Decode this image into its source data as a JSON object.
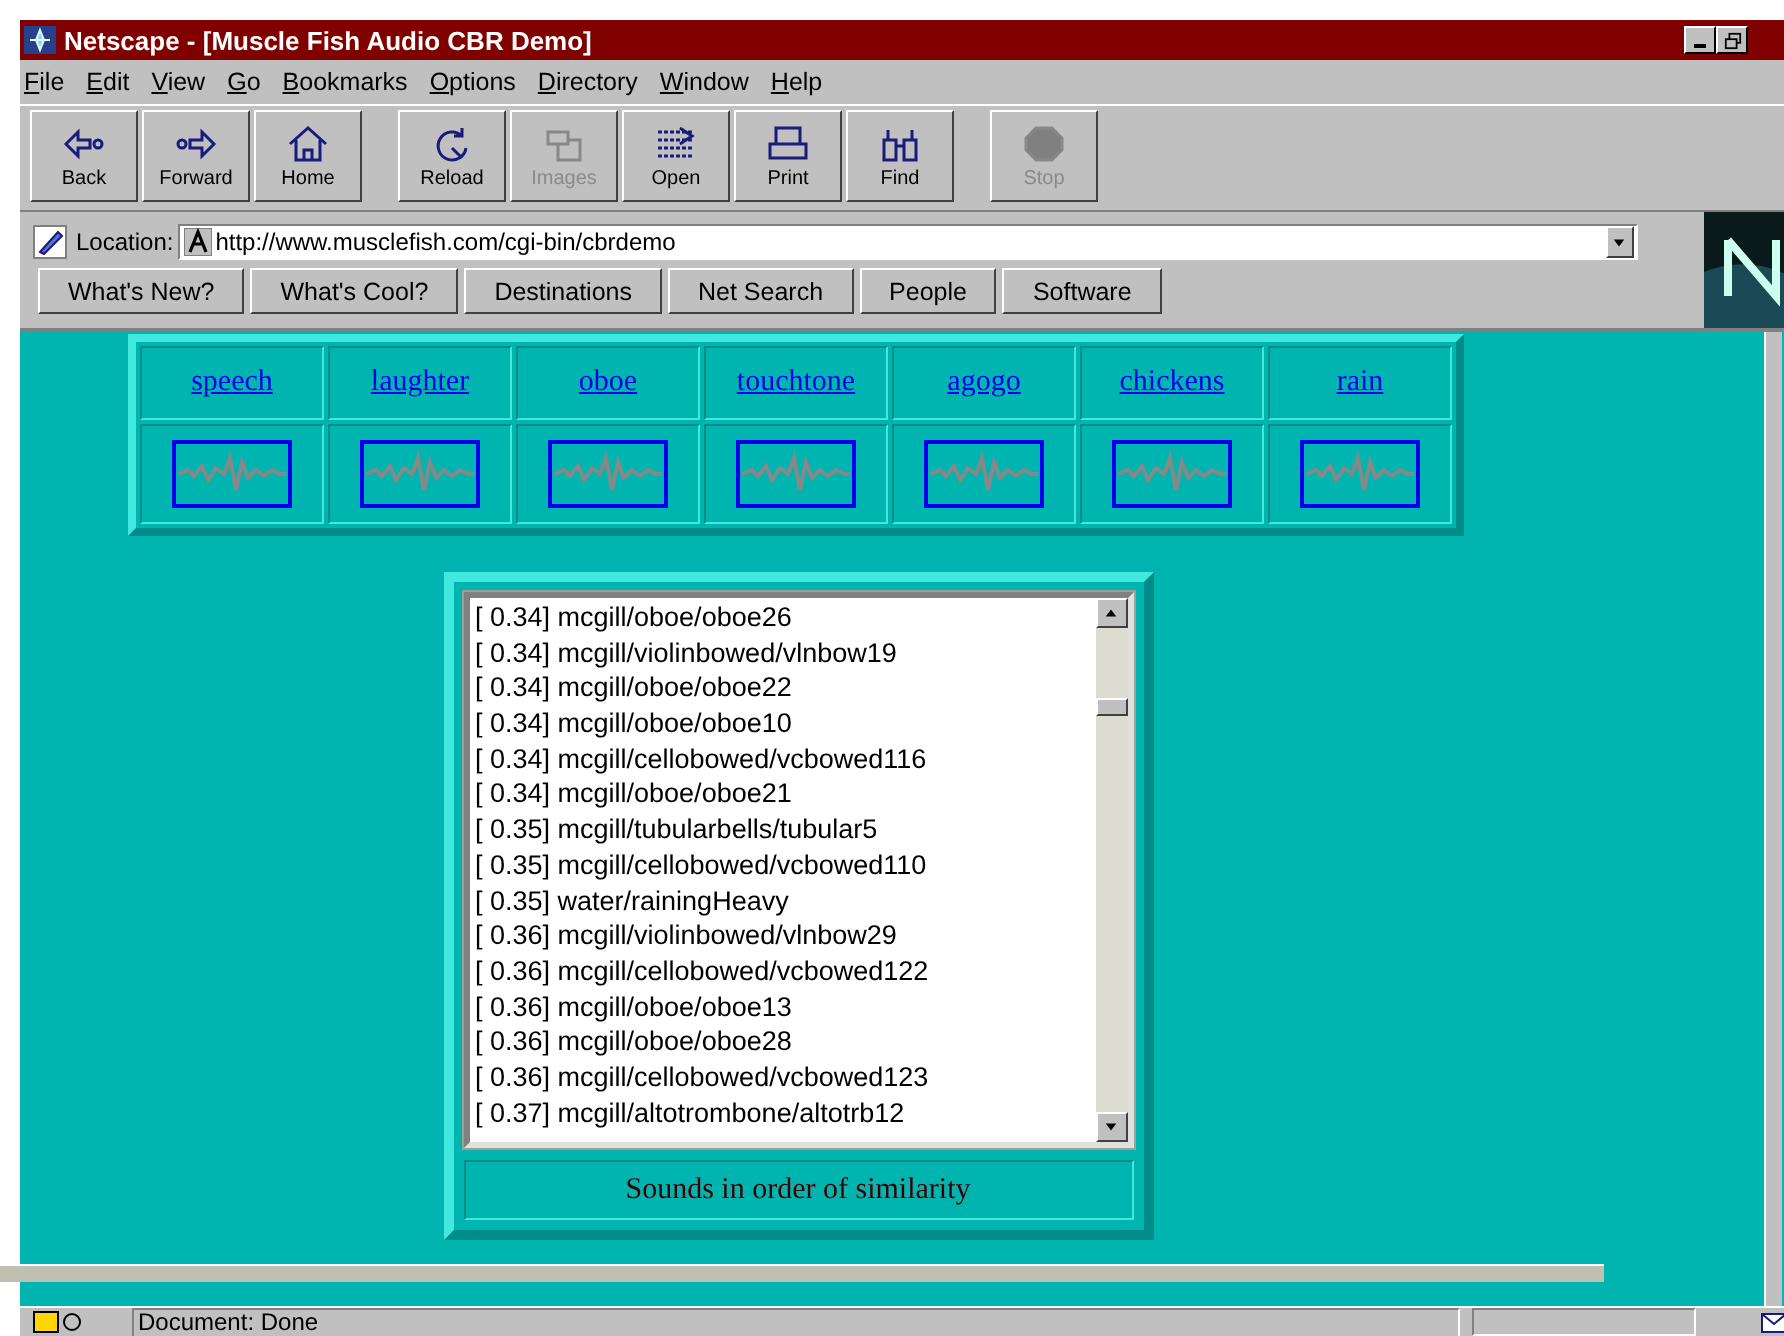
{
  "window": {
    "title": "Netscape - [Muscle Fish Audio CBR Demo]"
  },
  "menu": [
    "File",
    "Edit",
    "View",
    "Go",
    "Bookmarks",
    "Options",
    "Directory",
    "Window",
    "Help"
  ],
  "toolbar": [
    {
      "label": "Back",
      "disabled": false
    },
    {
      "label": "Forward",
      "disabled": false
    },
    {
      "label": "Home",
      "disabled": false
    },
    {
      "label": "Reload",
      "disabled": false
    },
    {
      "label": "Images",
      "disabled": true
    },
    {
      "label": "Open",
      "disabled": false
    },
    {
      "label": "Print",
      "disabled": false
    },
    {
      "label": "Find",
      "disabled": false
    },
    {
      "label": "Stop",
      "disabled": true
    }
  ],
  "location": {
    "label": "Location:",
    "url": "http://www.musclefish.com/cgi-bin/cbrdemo"
  },
  "directory_buttons": [
    "What's New?",
    "What's Cool?",
    "Destinations",
    "Net Search",
    "People",
    "Software"
  ],
  "sounds": [
    "speech",
    "laughter",
    "oboe",
    "touchtone",
    "agogo",
    "chickens",
    "rain"
  ],
  "results": [
    "[ 0.34] mcgill/oboe/oboe26",
    "[ 0.34] mcgill/violinbowed/vlnbow19",
    "[ 0.34] mcgill/oboe/oboe22",
    "[ 0.34] mcgill/oboe/oboe10",
    "[ 0.34] mcgill/cellobowed/vcbowed116",
    "[ 0.34] mcgill/oboe/oboe21",
    "[ 0.35] mcgill/tubularbells/tubular5",
    "[ 0.35] mcgill/cellobowed/vcbowed110",
    "[ 0.35] water/rainingHeavy",
    "[ 0.36] mcgill/violinbowed/vlnbow29",
    "[ 0.36] mcgill/cellobowed/vcbowed122",
    "[ 0.36] mcgill/oboe/oboe13",
    "[ 0.36] mcgill/oboe/oboe28",
    "[ 0.36] mcgill/cellobowed/vcbowed123",
    "[ 0.37] mcgill/altotrombone/altotrb12"
  ],
  "results_caption": "Sounds in order of similarity",
  "status_bar": {
    "text": "Document: Done"
  }
}
